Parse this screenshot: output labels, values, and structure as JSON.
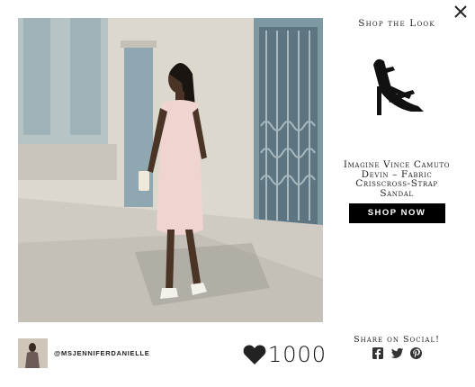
{
  "modal": {
    "close_icon": "close-icon"
  },
  "photo": {
    "alt": "Woman in pink dress and white strappy sandals on sidewalk"
  },
  "shop": {
    "title": "Shop the Look",
    "product_name": "Imagine Vince Camuto Devin – Fabric Crisscross-Strap Sandal",
    "shop_now_label": "SHOP NOW",
    "button_color": "#000000"
  },
  "footer": {
    "username": "@MSJENNIFERDANIELLE",
    "like_count": "1000",
    "heart_icon": "heart-icon",
    "share_title": "Share on Social!",
    "share_icons": [
      "facebook-icon",
      "twitter-icon",
      "pinterest-icon"
    ]
  }
}
